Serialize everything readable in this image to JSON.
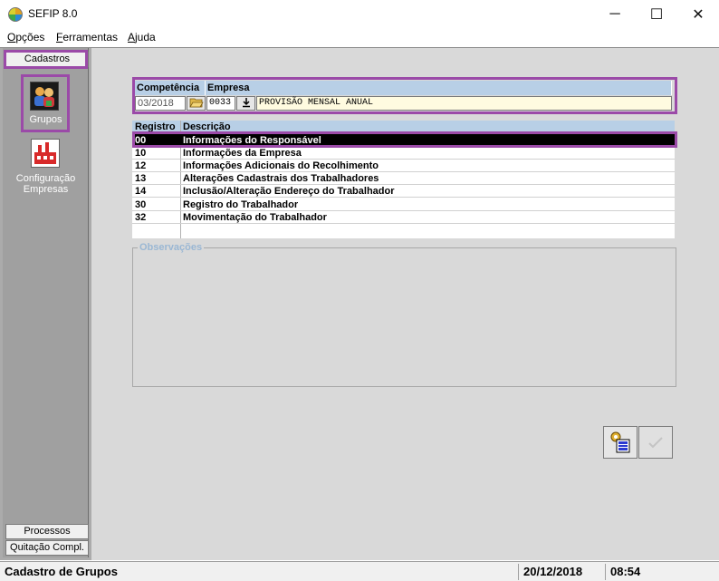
{
  "window": {
    "title": "SEFIP 8.0",
    "minimize": "─",
    "maximize": "☐",
    "close": "✕"
  },
  "menu": {
    "items": [
      {
        "first": "O",
        "rest": "pções"
      },
      {
        "first": "F",
        "rest": "erramentas"
      },
      {
        "first": "A",
        "rest": "juda"
      }
    ]
  },
  "sidebar": {
    "top_tab": "Cadastros",
    "items": [
      {
        "label": "Grupos",
        "icon": "group-users-icon"
      },
      {
        "label_line1": "Configuração",
        "label_line2": "Empresas",
        "icon": "company-config-icon"
      }
    ],
    "bottom_tabs": [
      "Processos",
      "Quitação Compl."
    ]
  },
  "header": {
    "competencia_label": "Competência",
    "empresa_label": "Empresa",
    "competencia_value": "03/2018",
    "empresa_code": "0033",
    "empresa_name": "PROVISÃO MENSAL ANUAL",
    "folder_icon": "folder-open-icon",
    "down_icon": "download-arrow-icon"
  },
  "grid": {
    "col_registro": "Registro",
    "col_descricao": "Descrição",
    "rows": [
      {
        "code": "00",
        "desc": "Informações do Responsável"
      },
      {
        "code": "10",
        "desc": "Informações da Empresa"
      },
      {
        "code": "12",
        "desc": "Informações Adicionais do Recolhimento"
      },
      {
        "code": "13",
        "desc": "Alterações Cadastrais dos Trabalhadores"
      },
      {
        "code": "14",
        "desc": "Inclusão/Alteração Endereço do Trabalhador"
      },
      {
        "code": "30",
        "desc": "Registro do Trabalhador"
      },
      {
        "code": "32",
        "desc": "Movimentação do Trabalhador"
      }
    ],
    "selected_row": 0
  },
  "observacoes": {
    "legend": "Observações"
  },
  "actions": {
    "execute_icon": "execute-gear-icon",
    "confirm_icon": "check-icon"
  },
  "status": {
    "text": "Cadastro de Grupos",
    "date": "20/12/2018",
    "time": "08:54"
  },
  "colors": {
    "highlight": "#9b4aa8",
    "header_blue": "#b8cfe6",
    "selected_row": "#000000"
  }
}
